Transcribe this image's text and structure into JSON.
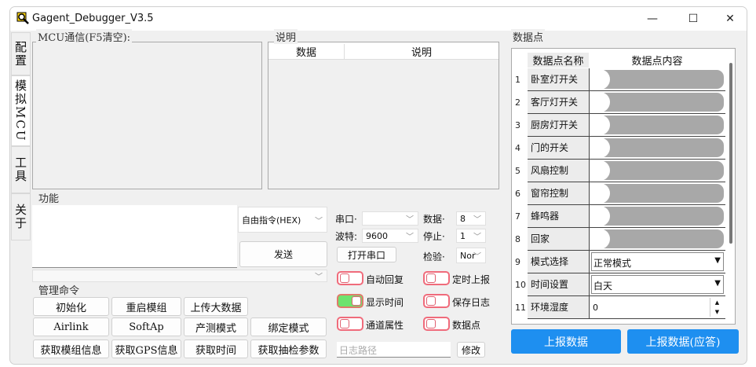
{
  "window": {
    "title": "Gagent_Debugger_V3.5",
    "minimize": "—",
    "maximize": "☐",
    "close": "✕"
  },
  "tabs": [
    {
      "label": "配置"
    },
    {
      "label": "模拟MCU"
    },
    {
      "label": "工具"
    },
    {
      "label": "关于"
    }
  ],
  "mcu": {
    "label": "MCU通信(F5清空):"
  },
  "desc": {
    "label": "说明",
    "col_data": "数据",
    "col_desc": "说明"
  },
  "func": {
    "label": "功能",
    "command_type": "自由指令(HEX)",
    "send": "发送",
    "history": ""
  },
  "mgmt": {
    "label": "管理命令",
    "buttons": [
      "初始化",
      "重启模组",
      "上传大数据",
      "",
      "Airlink",
      "SoftAp",
      "产测模式",
      "绑定模式",
      "获取模组信息",
      "获取GPS信息",
      "获取时间",
      "获取抽检参数"
    ]
  },
  "serial": {
    "port_label": "串口·",
    "port": "",
    "data_label": "数据·",
    "data": "8",
    "baud_label": "波特:",
    "baud": "9600",
    "stop_label": "停止·",
    "stop": "1",
    "open": "打开串口",
    "parity_label": "检验·",
    "parity": "Nor",
    "toggles": [
      {
        "label": "自动回复",
        "on": false
      },
      {
        "label": "定时上报",
        "on": false
      },
      {
        "label": "显示时间",
        "on": true
      },
      {
        "label": "保存日志",
        "on": false
      },
      {
        "label": "通道属性",
        "on": false
      },
      {
        "label": "数据点",
        "on": false
      }
    ],
    "log_placeholder": "日志路径",
    "modify": "修改"
  },
  "datapoints": {
    "label": "数据点",
    "col_name": "数据点名称",
    "col_content": "数据点内容",
    "rows": [
      {
        "n": "1",
        "name": "卧室灯开关",
        "type": "switch"
      },
      {
        "n": "2",
        "name": "客厅灯开关",
        "type": "switch"
      },
      {
        "n": "3",
        "name": "厨房灯开关",
        "type": "switch"
      },
      {
        "n": "4",
        "name": "门的开关",
        "type": "switch"
      },
      {
        "n": "5",
        "name": "风扇控制",
        "type": "switch"
      },
      {
        "n": "6",
        "name": "窗帘控制",
        "type": "switch"
      },
      {
        "n": "7",
        "name": "蜂鸣器",
        "type": "switch"
      },
      {
        "n": "8",
        "name": "回家",
        "type": "switch"
      },
      {
        "n": "9",
        "name": "模式选择",
        "type": "enum",
        "value": "正常模式"
      },
      {
        "n": "10",
        "name": "时间设置",
        "type": "enum",
        "value": "白天"
      },
      {
        "n": "11",
        "name": "环境湿度",
        "type": "number",
        "value": "0"
      }
    ],
    "report": "上报数据",
    "report_ack": "上报数据(应答)"
  }
}
